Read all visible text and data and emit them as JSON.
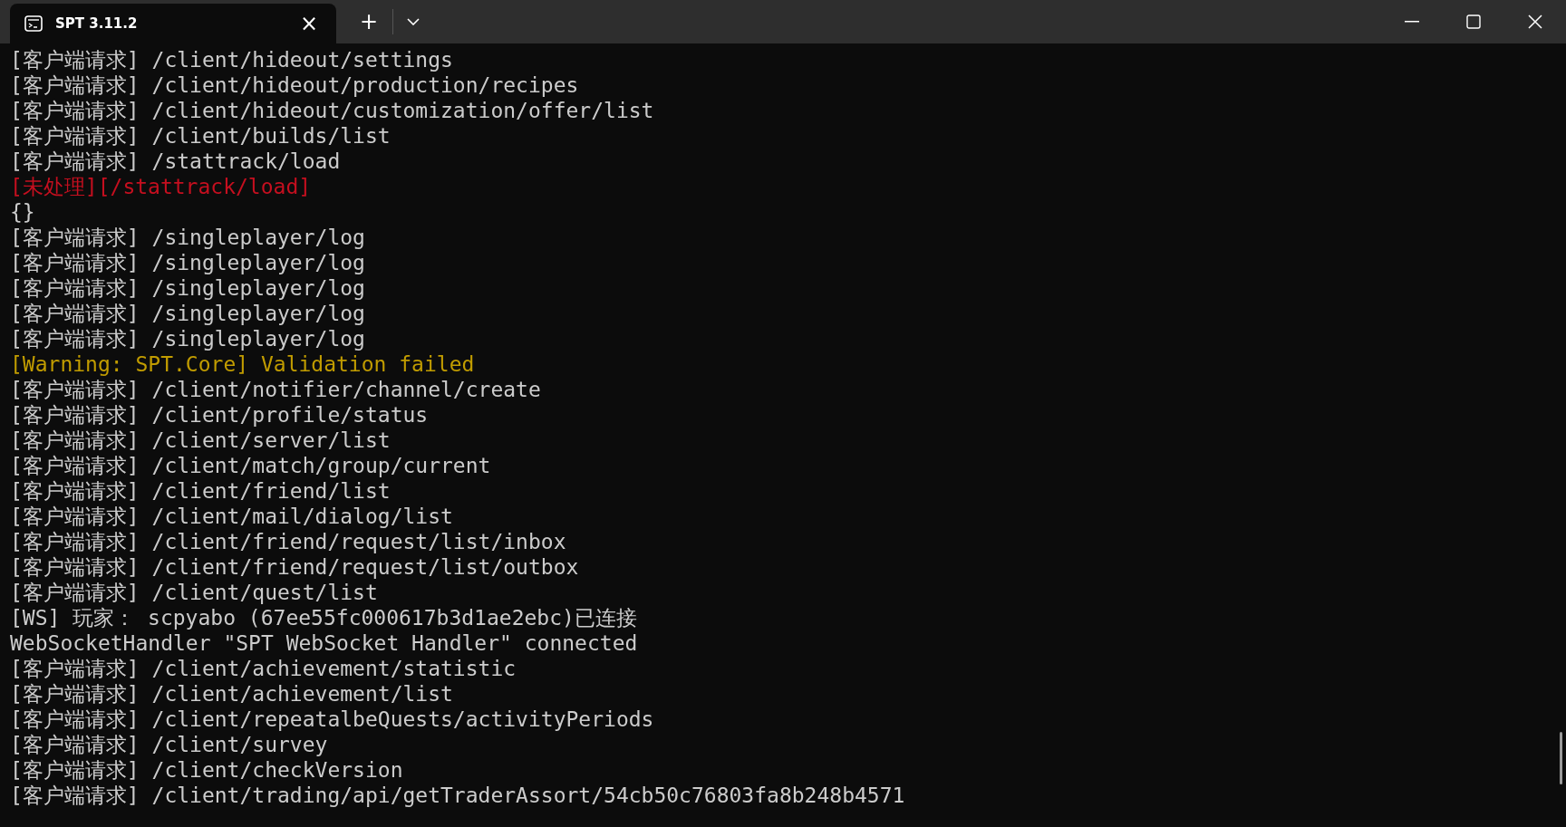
{
  "window": {
    "tab_title": "SPT 3.11.2",
    "tab_close": "×",
    "new_tab": "+"
  },
  "console": {
    "lines": [
      {
        "kind": "normal",
        "text": "[客户端请求] /client/hideout/settings"
      },
      {
        "kind": "normal",
        "text": "[客户端请求] /client/hideout/production/recipes"
      },
      {
        "kind": "normal",
        "text": "[客户端请求] /client/hideout/customization/offer/list"
      },
      {
        "kind": "normal",
        "text": "[客户端请求] /client/builds/list"
      },
      {
        "kind": "normal",
        "text": "[客户端请求] /stattrack/load"
      },
      {
        "kind": "error",
        "text": "[未处理][/stattrack/load]"
      },
      {
        "kind": "normal",
        "text": "{}"
      },
      {
        "kind": "normal",
        "text": "[客户端请求] /singleplayer/log"
      },
      {
        "kind": "normal",
        "text": "[客户端请求] /singleplayer/log"
      },
      {
        "kind": "normal",
        "text": "[客户端请求] /singleplayer/log"
      },
      {
        "kind": "normal",
        "text": "[客户端请求] /singleplayer/log"
      },
      {
        "kind": "normal",
        "text": "[客户端请求] /singleplayer/log"
      },
      {
        "kind": "warning",
        "text": "[Warning: SPT.Core] Validation failed"
      },
      {
        "kind": "normal",
        "text": "[客户端请求] /client/notifier/channel/create"
      },
      {
        "kind": "normal",
        "text": "[客户端请求] /client/profile/status"
      },
      {
        "kind": "normal",
        "text": "[客户端请求] /client/server/list"
      },
      {
        "kind": "normal",
        "text": "[客户端请求] /client/match/group/current"
      },
      {
        "kind": "normal",
        "text": "[客户端请求] /client/friend/list"
      },
      {
        "kind": "normal",
        "text": "[客户端请求] /client/mail/dialog/list"
      },
      {
        "kind": "normal",
        "text": "[客户端请求] /client/friend/request/list/inbox"
      },
      {
        "kind": "normal",
        "text": "[客户端请求] /client/friend/request/list/outbox"
      },
      {
        "kind": "normal",
        "text": "[客户端请求] /client/quest/list"
      },
      {
        "kind": "normal",
        "text": "[WS] 玩家： scpyabo (67ee55fc000617b3d1ae2ebc)已连接"
      },
      {
        "kind": "normal",
        "text": "WebSocketHandler \"SPT WebSocket Handler\" connected"
      },
      {
        "kind": "normal",
        "text": "[客户端请求] /client/achievement/statistic"
      },
      {
        "kind": "normal",
        "text": "[客户端请求] /client/achievement/list"
      },
      {
        "kind": "normal",
        "text": "[客户端请求] /client/repeatalbeQuests/activityPeriods"
      },
      {
        "kind": "normal",
        "text": "[客户端请求] /client/survey"
      },
      {
        "kind": "normal",
        "text": "[客户端请求] /client/checkVersion"
      },
      {
        "kind": "normal",
        "text": "[客户端请求] /client/trading/api/getTraderAssort/54cb50c76803fa8b248b4571"
      }
    ]
  }
}
